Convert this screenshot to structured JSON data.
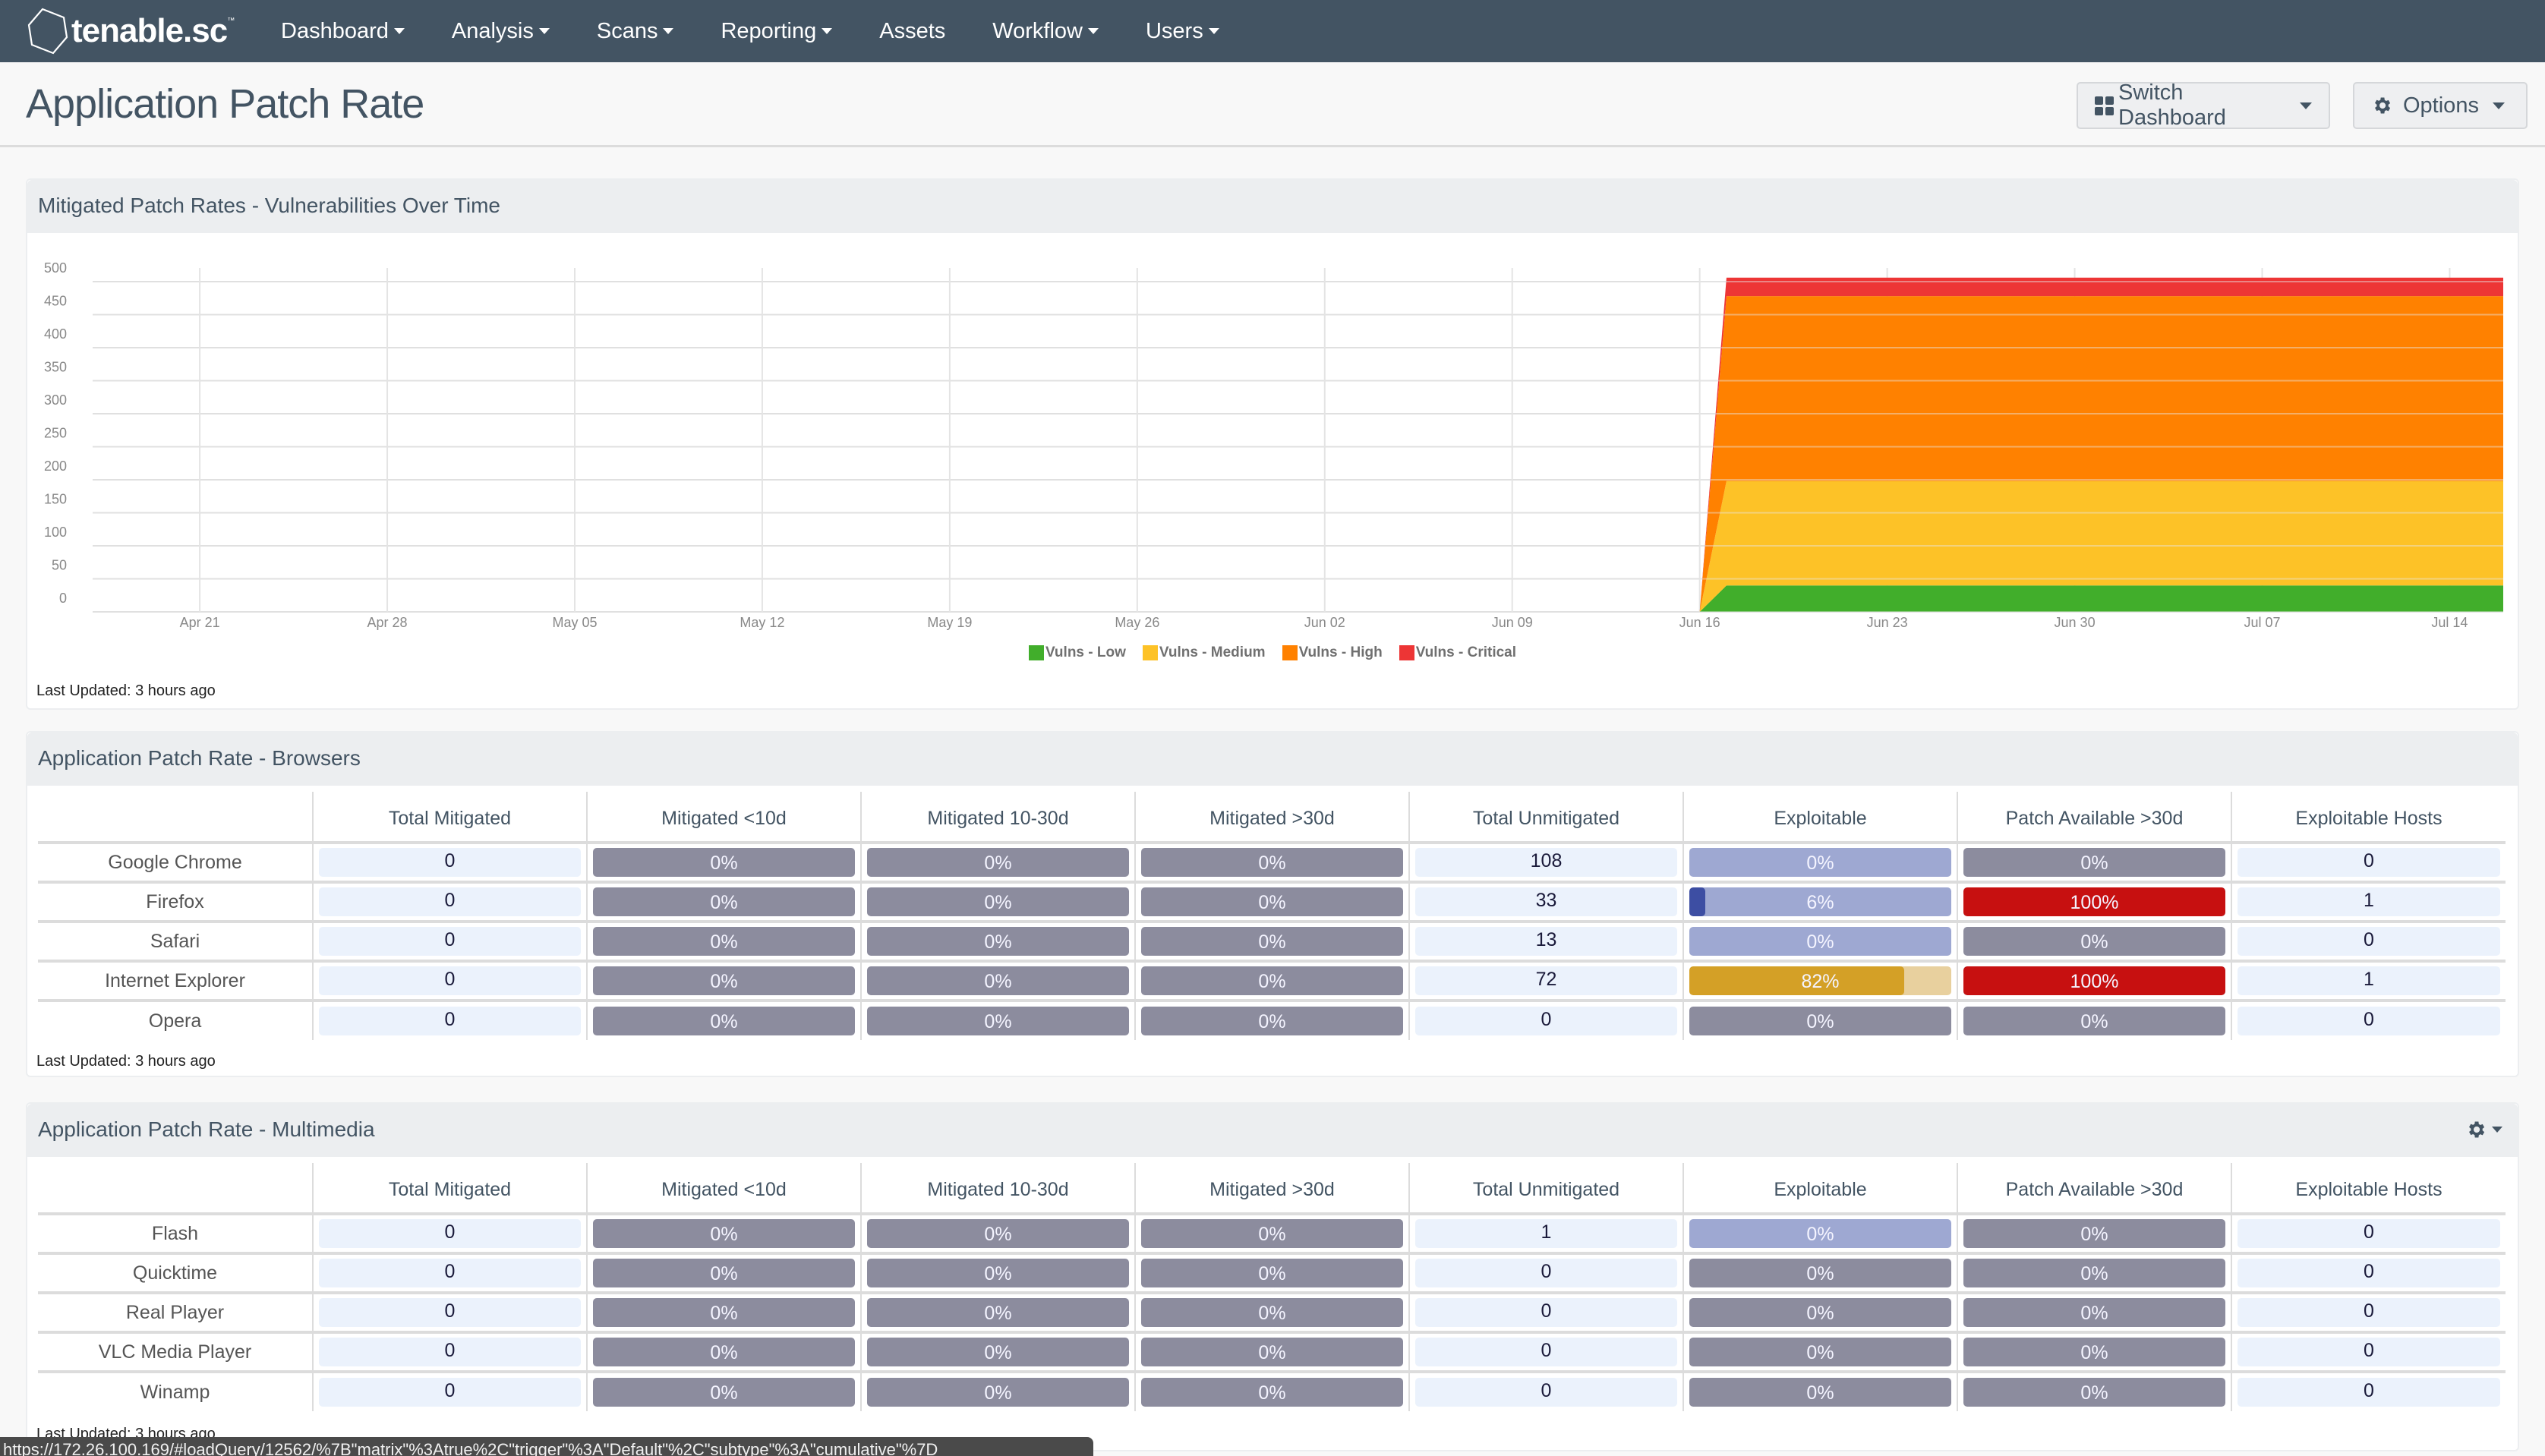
{
  "app": {
    "logo_text": "tenable.sc",
    "logo_tm": "™"
  },
  "nav": {
    "items": [
      {
        "label": "Dashboard",
        "dropdown": true
      },
      {
        "label": "Analysis",
        "dropdown": true
      },
      {
        "label": "Scans",
        "dropdown": true
      },
      {
        "label": "Reporting",
        "dropdown": true
      },
      {
        "label": "Assets",
        "dropdown": false
      },
      {
        "label": "Workflow",
        "dropdown": true
      },
      {
        "label": "Users",
        "dropdown": true
      }
    ]
  },
  "page": {
    "title": "Application Patch Rate",
    "switch_dashboard_label": "Switch Dashboard",
    "options_label": "Options"
  },
  "colors": {
    "nav_bg": "#435463",
    "low": "#41ae2b",
    "medium": "#fdc227",
    "high": "#ff8100",
    "critical": "#ed3535",
    "bar_gray": "#8c8c9e",
    "bar_light_blue": "#9ea8d2",
    "bar_dark_blue": "#3d4ea3",
    "bar_red": "#c71010",
    "bar_gold": "#d4a026",
    "bar_gold_bg": "#e8d09e"
  },
  "chart_panel": {
    "title": "Mitigated Patch Rates - Vulnerabilities Over Time",
    "last_updated": "Last Updated: 3 hours ago"
  },
  "chart_data": {
    "type": "area",
    "stacked": true,
    "title": "Mitigated Patch Rates - Vulnerabilities Over Time",
    "xlabel": "",
    "ylabel": "",
    "ylim": [
      0,
      500
    ],
    "yticks": [
      0,
      50,
      100,
      150,
      200,
      250,
      300,
      350,
      400,
      450,
      500
    ],
    "x_range_days": [
      "Apr 17",
      "Jul 16"
    ],
    "xtick_labels": [
      "Apr 21",
      "Apr 28",
      "May 05",
      "May 12",
      "May 19",
      "May 26",
      "Jun 02",
      "Jun 09",
      "Jun 16",
      "Jun 23",
      "Jun 30",
      "Jul 07",
      "Jul 14"
    ],
    "grid": true,
    "legend_position": "bottom-center",
    "x": [
      "Apr 17",
      "Jun 16",
      "Jun 17",
      "Jul 16"
    ],
    "series": [
      {
        "name": "Vulns - Low",
        "color": "#41ae2b",
        "values": [
          0,
          0,
          40,
          40
        ]
      },
      {
        "name": "Vulns - Medium",
        "color": "#fdc227",
        "values": [
          0,
          0,
          158,
          158
        ]
      },
      {
        "name": "Vulns - High",
        "color": "#ff8100",
        "values": [
          0,
          0,
          280,
          280
        ]
      },
      {
        "name": "Vulns - Critical",
        "color": "#ed3535",
        "values": [
          0,
          0,
          28,
          28
        ]
      }
    ]
  },
  "columns": [
    "",
    "Total Mitigated",
    "Mitigated <10d",
    "Mitigated 10-30d",
    "Mitigated >30d",
    "Total Unmitigated",
    "Exploitable",
    "Patch Available >30d",
    "Exploitable Hosts"
  ],
  "browsers": {
    "title": "Application Patch Rate - Browsers",
    "last_updated": "Last Updated: 3 hours ago",
    "rows": [
      {
        "name": "Google Chrome",
        "total_mitigated": "0",
        "mit_lt10": "0%",
        "mit_10_30": "0%",
        "mit_gt30": "0%",
        "total_unmitigated": "108",
        "exploitable": "0%",
        "exploitable_pct": 0,
        "exploitable_style": "light-blue",
        "patch_gt30": "0%",
        "patch_pct": 0,
        "patch_style": "gray",
        "exploitable_hosts": "0"
      },
      {
        "name": "Firefox",
        "total_mitigated": "0",
        "mit_lt10": "0%",
        "mit_10_30": "0%",
        "mit_gt30": "0%",
        "total_unmitigated": "33",
        "exploitable": "6%",
        "exploitable_pct": 6,
        "exploitable_style": "light-blue",
        "patch_gt30": "100%",
        "patch_pct": 100,
        "patch_style": "red",
        "exploitable_hosts": "1"
      },
      {
        "name": "Safari",
        "total_mitigated": "0",
        "mit_lt10": "0%",
        "mit_10_30": "0%",
        "mit_gt30": "0%",
        "total_unmitigated": "13",
        "exploitable": "0%",
        "exploitable_pct": 0,
        "exploitable_style": "light-blue",
        "patch_gt30": "0%",
        "patch_pct": 0,
        "patch_style": "gray",
        "exploitable_hosts": "0"
      },
      {
        "name": "Internet Explorer",
        "total_mitigated": "0",
        "mit_lt10": "0%",
        "mit_10_30": "0%",
        "mit_gt30": "0%",
        "total_unmitigated": "72",
        "exploitable": "82%",
        "exploitable_pct": 82,
        "exploitable_style": "gold",
        "patch_gt30": "100%",
        "patch_pct": 100,
        "patch_style": "red",
        "exploitable_hosts": "1"
      },
      {
        "name": "Opera",
        "total_mitigated": "0",
        "mit_lt10": "0%",
        "mit_10_30": "0%",
        "mit_gt30": "0%",
        "total_unmitigated": "0",
        "exploitable": "0%",
        "exploitable_pct": 0,
        "exploitable_style": "gray",
        "patch_gt30": "0%",
        "patch_pct": 0,
        "patch_style": "gray",
        "exploitable_hosts": "0"
      }
    ]
  },
  "multimedia": {
    "title": "Application Patch Rate - Multimedia",
    "last_updated": "Last Updated: 3 hours ago",
    "rows": [
      {
        "name": "Flash",
        "total_mitigated": "0",
        "mit_lt10": "0%",
        "mit_10_30": "0%",
        "mit_gt30": "0%",
        "total_unmitigated": "1",
        "exploitable": "0%",
        "exploitable_pct": 0,
        "exploitable_style": "light-blue",
        "patch_gt30": "0%",
        "patch_pct": 0,
        "patch_style": "gray",
        "exploitable_hosts": "0"
      },
      {
        "name": "Quicktime",
        "total_mitigated": "0",
        "mit_lt10": "0%",
        "mit_10_30": "0%",
        "mit_gt30": "0%",
        "total_unmitigated": "0",
        "exploitable": "0%",
        "exploitable_pct": 0,
        "exploitable_style": "gray",
        "patch_gt30": "0%",
        "patch_pct": 0,
        "patch_style": "gray",
        "exploitable_hosts": "0"
      },
      {
        "name": "Real Player",
        "total_mitigated": "0",
        "mit_lt10": "0%",
        "mit_10_30": "0%",
        "mit_gt30": "0%",
        "total_unmitigated": "0",
        "exploitable": "0%",
        "exploitable_pct": 0,
        "exploitable_style": "gray",
        "patch_gt30": "0%",
        "patch_pct": 0,
        "patch_style": "gray",
        "exploitable_hosts": "0"
      },
      {
        "name": "VLC Media Player",
        "total_mitigated": "0",
        "mit_lt10": "0%",
        "mit_10_30": "0%",
        "mit_gt30": "0%",
        "total_unmitigated": "0",
        "exploitable": "0%",
        "exploitable_pct": 0,
        "exploitable_style": "gray",
        "patch_gt30": "0%",
        "patch_pct": 0,
        "patch_style": "gray",
        "exploitable_hosts": "0"
      },
      {
        "name": "Winamp",
        "total_mitigated": "0",
        "mit_lt10": "0%",
        "mit_10_30": "0%",
        "mit_gt30": "0%",
        "total_unmitigated": "0",
        "exploitable": "0%",
        "exploitable_pct": 0,
        "exploitable_style": "gray",
        "patch_gt30": "0%",
        "patch_pct": 0,
        "patch_style": "gray",
        "exploitable_hosts": "0"
      }
    ]
  },
  "statusbar": {
    "url": "https://172.26.100.169/#loadQuery/12562/%7B\"matrix\"%3Atrue%2C\"trigger\"%3A\"Default\"%2C\"subtype\"%3A\"cumulative\"%7D"
  }
}
